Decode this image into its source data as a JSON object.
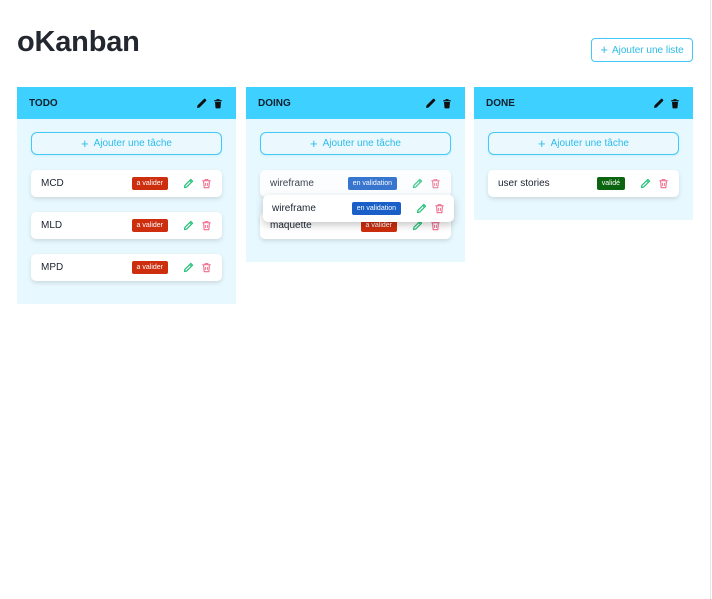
{
  "app": {
    "title": "oKanban",
    "add_list_label": "Ajouter une liste"
  },
  "colors": {
    "accent": "#3ed0ff",
    "list_bg": "#e7f8fe",
    "badge_a_valider": "#cc2e0e",
    "badge_en_validation": "#1a5fc7",
    "badge_valide": "#0b6510",
    "edit_icon": "#27c27a",
    "delete_icon": "#f06a8c"
  },
  "lists": [
    {
      "title": "TODO",
      "add_task_label": "Ajouter une tâche",
      "cards": [
        {
          "name": "MCD",
          "badge": "a valider"
        },
        {
          "name": "MLD",
          "badge": "a valider"
        },
        {
          "name": "MPD",
          "badge": "a valider"
        }
      ]
    },
    {
      "title": "DOING",
      "add_task_label": "Ajouter une tâche",
      "cards": [
        {
          "name": "wireframe",
          "badge": "en validation"
        },
        {
          "name": "maquette",
          "badge": "a valider"
        }
      ]
    },
    {
      "title": "DONE",
      "add_task_label": "Ajouter une tâche",
      "cards": [
        {
          "name": "user stories",
          "badge": "validé"
        }
      ]
    }
  ],
  "dragging_card": {
    "name": "wireframe",
    "badge": "en validation"
  },
  "icons": {
    "plus": "+",
    "list_edit": "pencil-icon",
    "list_delete": "trash-icon",
    "card_edit": "pencil-icon",
    "card_delete": "trash-icon"
  }
}
